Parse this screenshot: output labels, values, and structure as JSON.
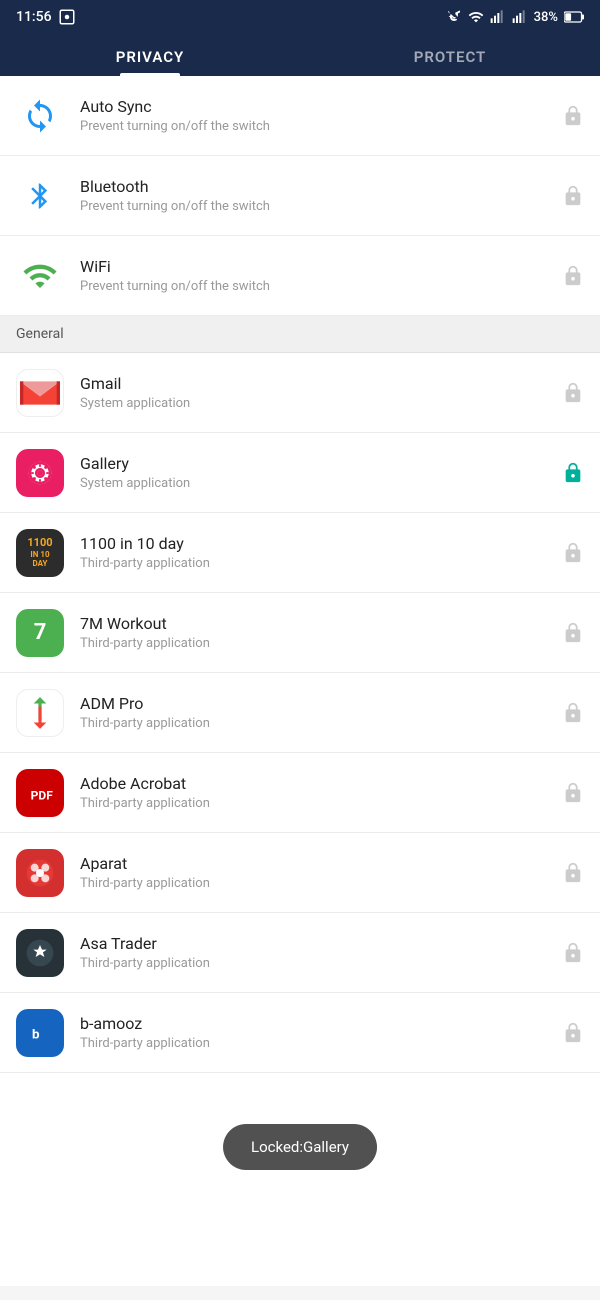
{
  "statusBar": {
    "time": "11:56",
    "battery": "38%"
  },
  "tabs": [
    {
      "id": "privacy",
      "label": "PRIVACY",
      "active": true
    },
    {
      "id": "protect",
      "label": "PROTECT",
      "active": false
    }
  ],
  "topItems": [
    {
      "id": "autosync",
      "title": "Auto Sync",
      "subtitle": "Prevent turning on/off the switch",
      "iconType": "autosync",
      "locked": false
    },
    {
      "id": "bluetooth",
      "title": "Bluetooth",
      "subtitle": "Prevent turning on/off the switch",
      "iconType": "bluetooth",
      "locked": false
    },
    {
      "id": "wifi",
      "title": "WiFi",
      "subtitle": "Prevent turning on/off the switch",
      "iconType": "wifi",
      "locked": false
    }
  ],
  "sectionHeader": "General",
  "appItems": [
    {
      "id": "gmail",
      "title": "Gmail",
      "subtitle": "System application",
      "iconType": "gmail",
      "locked": false
    },
    {
      "id": "gallery",
      "title": "Gallery",
      "subtitle": "System application",
      "iconType": "gallery",
      "locked": true
    },
    {
      "id": "1100",
      "title": "1100 in 10 day",
      "subtitle": "Third-party application",
      "iconType": "1100",
      "locked": false
    },
    {
      "id": "7m",
      "title": "7M Workout",
      "subtitle": "Third-party application",
      "iconType": "7m",
      "locked": false
    },
    {
      "id": "adm",
      "title": "ADM Pro",
      "subtitle": "Third-party application",
      "iconType": "adm",
      "locked": false
    },
    {
      "id": "adobe",
      "title": "Adobe Acrobat",
      "subtitle": "Third-party application",
      "iconType": "adobe",
      "locked": false
    },
    {
      "id": "aparat",
      "title": "Aparat",
      "subtitle": "Third-party application",
      "iconType": "aparat",
      "locked": false
    },
    {
      "id": "asatrader",
      "title": "Asa Trader",
      "subtitle": "Third-party application",
      "iconType": "asatrader",
      "locked": false
    },
    {
      "id": "bamooz",
      "title": "b-amooz",
      "subtitle": "Third-party application",
      "iconType": "bamooz",
      "locked": false
    }
  ],
  "toast": {
    "text": "Locked:Gallery"
  }
}
